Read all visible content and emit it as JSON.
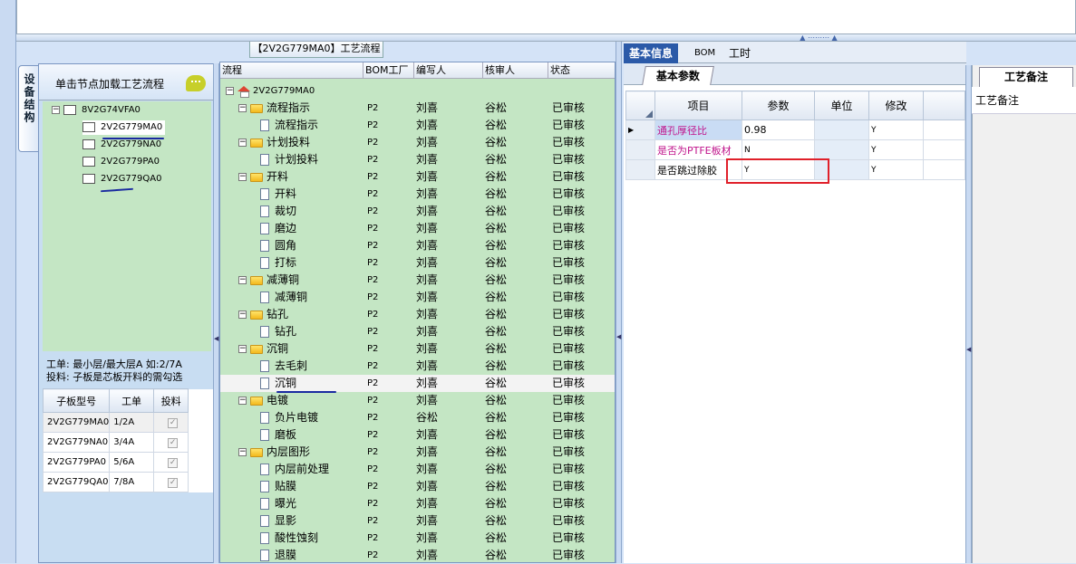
{
  "left_tab": "设备结构",
  "left_panel": {
    "header": "单击节点加载工艺流程",
    "tree": [
      {
        "label": "8V2G74VFA0"
      },
      {
        "label": "2V2G779MA0"
      },
      {
        "label": "2V2G779NA0"
      },
      {
        "label": "2V2G779PA0"
      },
      {
        "label": "2V2G779QA0"
      }
    ],
    "info_line1": "工单: 最小层/最大层A 如:2/7A",
    "info_line2": "投料: 子板是芯板开料的需勾选",
    "table_headers": [
      "子板型号",
      "工单",
      "投料"
    ],
    "table_rows": [
      {
        "model": "2V2G779MA0",
        "order": "1/2A"
      },
      {
        "model": "2V2G779NA0",
        "order": "3/4A"
      },
      {
        "model": "2V2G779PA0",
        "order": "5/6A"
      },
      {
        "model": "2V2G779QA0",
        "order": "7/8A"
      }
    ],
    "check_glyph": "✓"
  },
  "middle_panel": {
    "title": "【2V2G779MA0】工艺流程",
    "headers": [
      "流程",
      "BOM工厂",
      "编写人",
      "核审人",
      "状态"
    ],
    "root": "2V2G779MA0",
    "rows": [
      {
        "name": "流程指示",
        "folder": true,
        "bom": "P2",
        "writer": "刘喜",
        "reviewer": "谷松",
        "status": "已审核"
      },
      {
        "name": "流程指示",
        "folder": false,
        "bom": "P2",
        "writer": "刘喜",
        "reviewer": "谷松",
        "status": "已审核"
      },
      {
        "name": "计划投料",
        "folder": true,
        "bom": "P2",
        "writer": "刘喜",
        "reviewer": "谷松",
        "status": "已审核"
      },
      {
        "name": "计划投料",
        "folder": false,
        "bom": "P2",
        "writer": "刘喜",
        "reviewer": "谷松",
        "status": "已审核"
      },
      {
        "name": "开料",
        "folder": true,
        "bom": "P2",
        "writer": "刘喜",
        "reviewer": "谷松",
        "status": "已审核"
      },
      {
        "name": "开料",
        "folder": false,
        "bom": "P2",
        "writer": "刘喜",
        "reviewer": "谷松",
        "status": "已审核"
      },
      {
        "name": "裁切",
        "folder": false,
        "bom": "P2",
        "writer": "刘喜",
        "reviewer": "谷松",
        "status": "已审核"
      },
      {
        "name": "磨边",
        "folder": false,
        "bom": "P2",
        "writer": "刘喜",
        "reviewer": "谷松",
        "status": "已审核"
      },
      {
        "name": "圆角",
        "folder": false,
        "bom": "P2",
        "writer": "刘喜",
        "reviewer": "谷松",
        "status": "已审核"
      },
      {
        "name": "打标",
        "folder": false,
        "bom": "P2",
        "writer": "刘喜",
        "reviewer": "谷松",
        "status": "已审核"
      },
      {
        "name": "减薄铜",
        "folder": true,
        "bom": "P2",
        "writer": "刘喜",
        "reviewer": "谷松",
        "status": "已审核"
      },
      {
        "name": "减薄铜",
        "folder": false,
        "bom": "P2",
        "writer": "刘喜",
        "reviewer": "谷松",
        "status": "已审核"
      },
      {
        "name": "钻孔",
        "folder": true,
        "bom": "P2",
        "writer": "刘喜",
        "reviewer": "谷松",
        "status": "已审核"
      },
      {
        "name": "钻孔",
        "folder": false,
        "bom": "P2",
        "writer": "刘喜",
        "reviewer": "谷松",
        "status": "已审核"
      },
      {
        "name": "沉铜",
        "folder": true,
        "bom": "P2",
        "writer": "刘喜",
        "reviewer": "谷松",
        "status": "已审核"
      },
      {
        "name": "去毛刺",
        "folder": false,
        "bom": "P2",
        "writer": "刘喜",
        "reviewer": "谷松",
        "status": "已审核"
      },
      {
        "name": "沉铜",
        "folder": false,
        "bom": "P2",
        "writer": "刘喜",
        "reviewer": "谷松",
        "status": "已审核"
      },
      {
        "name": "电镀",
        "folder": true,
        "bom": "P2",
        "writer": "刘喜",
        "reviewer": "谷松",
        "status": "已审核"
      },
      {
        "name": "负片电镀",
        "folder": false,
        "bom": "P2",
        "writer": "谷松",
        "reviewer": "谷松",
        "status": "已审核"
      },
      {
        "name": "磨板",
        "folder": false,
        "bom": "P2",
        "writer": "刘喜",
        "reviewer": "谷松",
        "status": "已审核"
      },
      {
        "name": "内层图形",
        "folder": true,
        "bom": "P2",
        "writer": "刘喜",
        "reviewer": "谷松",
        "status": "已审核"
      },
      {
        "name": "内层前处理",
        "folder": false,
        "bom": "P2",
        "writer": "刘喜",
        "reviewer": "谷松",
        "status": "已审核"
      },
      {
        "name": "贴膜",
        "folder": false,
        "bom": "P2",
        "writer": "刘喜",
        "reviewer": "谷松",
        "status": "已审核"
      },
      {
        "name": "曝光",
        "folder": false,
        "bom": "P2",
        "writer": "刘喜",
        "reviewer": "谷松",
        "status": "已审核"
      },
      {
        "name": "显影",
        "folder": false,
        "bom": "P2",
        "writer": "刘喜",
        "reviewer": "谷松",
        "status": "已审核"
      },
      {
        "name": "酸性蚀刻",
        "folder": false,
        "bom": "P2",
        "writer": "刘喜",
        "reviewer": "谷松",
        "status": "已审核"
      },
      {
        "name": "退膜",
        "folder": false,
        "bom": "P2",
        "writer": "刘喜",
        "reviewer": "谷松",
        "status": "已审核"
      }
    ]
  },
  "right_panel": {
    "tabs": [
      "基本信息",
      "BOM",
      "工时"
    ],
    "subtab": "基本参数",
    "headers": [
      "项目",
      "参数",
      "单位",
      "修改"
    ],
    "rows": [
      {
        "item": "通孔厚径比",
        "value": "0.98",
        "unit": "",
        "modify": "Y"
      },
      {
        "item": "是否为PTFE板材",
        "value": "N",
        "unit": "",
        "modify": "Y"
      },
      {
        "item": "是否跳过除胶",
        "value": "Y",
        "unit": "",
        "modify": "Y"
      }
    ],
    "current_row_marker": "▶"
  },
  "far_right": {
    "tab": "工艺备注",
    "header": "工艺备注"
  },
  "colors": {
    "tree_bg": "#c4e6c4",
    "accent_tab": "#2b5aa8",
    "pink_text": "#c0148c",
    "highlight_box": "#e0202a"
  }
}
